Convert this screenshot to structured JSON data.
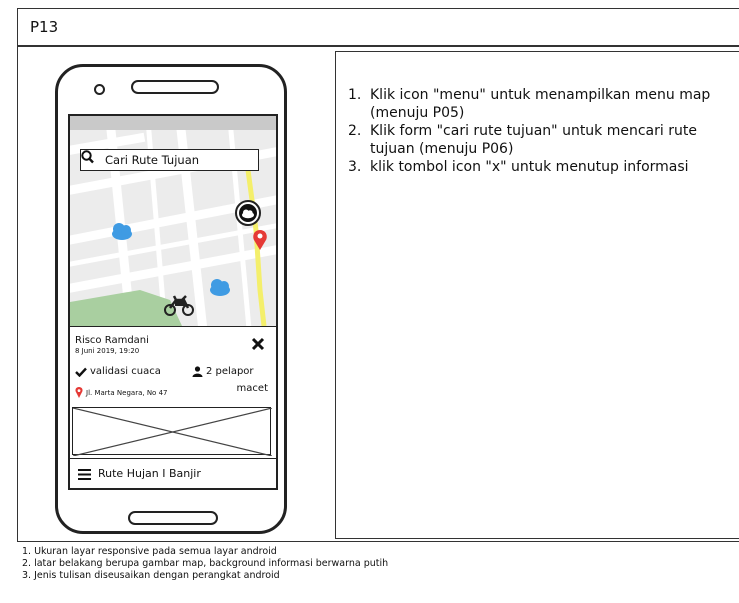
{
  "page": {
    "id": "P13"
  },
  "screen": {
    "search": {
      "placeholder": "Cari Rute Tujuan"
    },
    "card": {
      "name": "Risco Ramdani",
      "datetime": "8 Juni 2019, 19:20",
      "validation": "validasi cuaca",
      "reporters": "2 pelapor",
      "status": "macet",
      "address": "Jl. Marta Negara, No 47"
    },
    "bottom_bar": {
      "label": "Rute Hujan I Banjir"
    }
  },
  "instructions": [
    {
      "num": "1.",
      "text": "Klik icon \"menu\" untuk  menampilkan menu map (menuju P05)"
    },
    {
      "num": "2.",
      "text": "Klik form \"cari rute tujuan\" untuk mencari rute tujuan (menuju P06)"
    },
    {
      "num": "3.",
      "text": "klik tombol icon \"x\" untuk menutup informasi"
    }
  ],
  "notes": [
    "1. Ukuran layar responsive pada semua layar android",
    "2. latar belakang berupa gambar map, background informasi berwarna putih",
    "3. Jenis tulisan diseusaikan dengan perangkat android"
  ],
  "colors": {
    "status_bar": "#c9c9c9",
    "map_bg": "#ececec",
    "map_road": "#ffffff",
    "park": "#a9cfa0",
    "route": "#f4ef6b",
    "pin": "#e53935",
    "cloud": "#3f9be3"
  }
}
